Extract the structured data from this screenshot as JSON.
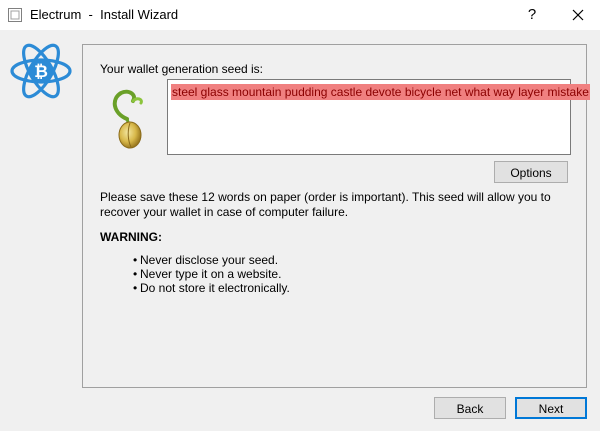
{
  "window": {
    "app_name": "Electrum",
    "separator": "-",
    "title": "Install Wizard",
    "help_label": "?"
  },
  "colors": {
    "seed_highlight": "#f08080",
    "seed_text": "#8b0000",
    "logo_blue": "#2c8bd6",
    "accent_focus": "#0078d7"
  },
  "icons": {
    "app": "electrum-icon",
    "logo": "electrum-bitcoin-logo",
    "seed": "sprouting-seed-icon",
    "close": "close-icon"
  },
  "seed_page": {
    "label": "Your wallet generation seed is:",
    "seed_words": "steel glass mountain pudding castle devote bicycle net what way layer mistake",
    "options_label": "Options",
    "info": "Please save these 12 words on paper (order is important). This seed will allow you to recover your wallet in case of computer failure.",
    "warning_title": "WARNING:",
    "warnings": [
      "Never disclose your seed.",
      "Never type it on a website.",
      "Do not store it electronically."
    ],
    "bullet": "•"
  },
  "footer": {
    "back_label": "Back",
    "next_label": "Next"
  }
}
